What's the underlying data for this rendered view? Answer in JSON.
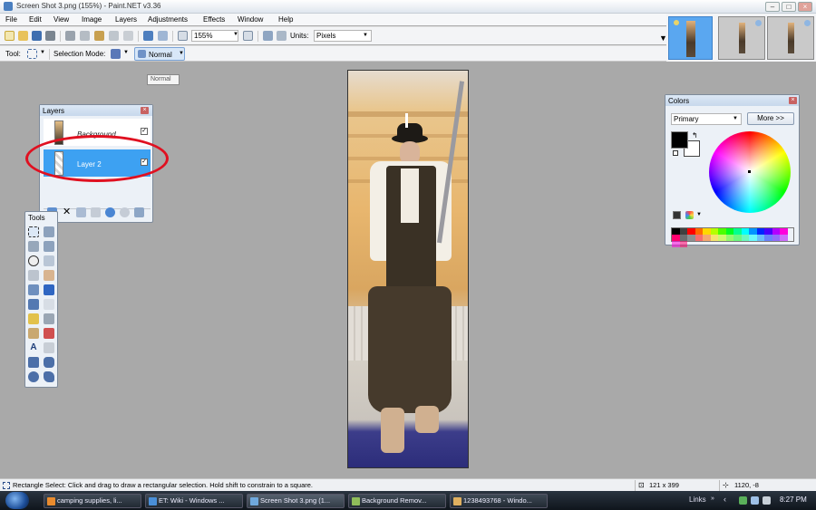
{
  "window": {
    "title": "Screen Shot 3.png (155%) - Paint.NET v3.36"
  },
  "menu": [
    "File",
    "Edit",
    "View",
    "Image",
    "Layers",
    "Adjustments",
    "Effects",
    "Window",
    "Help"
  ],
  "toolbar": {
    "zoom_value": "155%",
    "units_label": "Units:",
    "units_value": "Pixels"
  },
  "toolbar2": {
    "tool_label": "Tool:",
    "selection_mode_label": "Selection Mode:",
    "blend_value": "Normal"
  },
  "tooltip": {
    "text": "Normal"
  },
  "layers_panel": {
    "title": "Layers",
    "layers": [
      {
        "name": "Background"
      },
      {
        "name": "Layer 2"
      }
    ]
  },
  "tools_panel": {
    "title": "Tools"
  },
  "colors_panel": {
    "title": "Colors",
    "mode": "Primary",
    "more_label": "More >>",
    "palette": [
      "#000000",
      "#404040",
      "#ff0000",
      "#ff6a00",
      "#ffd800",
      "#b6ff00",
      "#4cff00",
      "#00ff21",
      "#00ff90",
      "#00ffff",
      "#0094ff",
      "#0026ff",
      "#4800ff",
      "#b200ff",
      "#ff00dc",
      "#ff006e"
    ]
  },
  "status": {
    "hint": "Rectangle Select: Click and drag to draw a rectangular selection. Hold shift to constrain to a square.",
    "size": "121 x 399",
    "position": "1120, -8"
  },
  "taskbar": {
    "items": [
      {
        "label": "camping supplies, li...",
        "color": "#e98b2e"
      },
      {
        "label": "ET: Wiki - Windows ...",
        "color": "#4a8fd8"
      },
      {
        "label": "Screen Shot 3.png (1...",
        "color": "#6fa8dc"
      },
      {
        "label": "Background Remov...",
        "color": "#8fbc5a"
      },
      {
        "label": "1238493768 - Windo...",
        "color": "#e0b060"
      }
    ],
    "links_label": "Links",
    "clock": "8:27 PM"
  }
}
